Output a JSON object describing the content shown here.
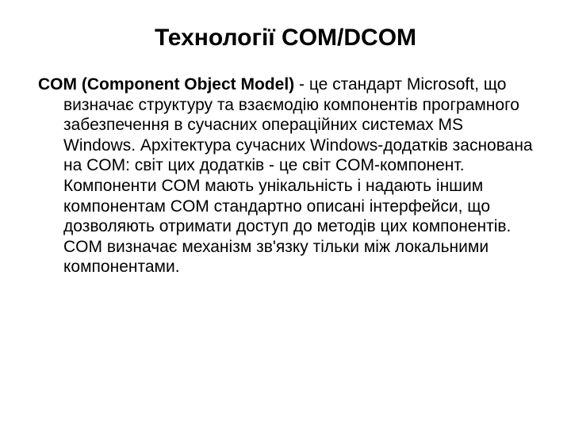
{
  "slide": {
    "title": "Технології COM/DCOM",
    "lead": "COM (Component Object Model)",
    "body": " - це стандарт Microsoft, що визначає структуру та взаємодію компонентів програмного забезпечення в сучасних операційних системах MS Windows. Архітектура сучасних Windows-додатків заснована на COM: світ цих додатків - це світ COM-компонент. Компоненти COM мають унікальність і надають іншим компонентам COM стандартно описані інтерфейси, що дозволяють отримати доступ до методів цих компонентів. COM визначає механізм зв'язку тільки між локальними компонентами."
  }
}
